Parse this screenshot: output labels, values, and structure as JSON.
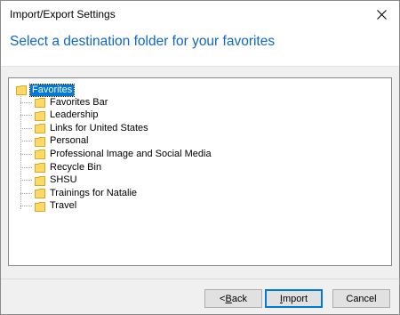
{
  "window": {
    "title": "Import/Export Settings",
    "close_icon": "close-icon"
  },
  "header": {
    "text": "Select a destination folder for your favorites",
    "color": "#0f66c8"
  },
  "tree": {
    "root": {
      "label": "Favorites",
      "selected": true
    },
    "items": [
      {
        "label": "Favorites Bar"
      },
      {
        "label": "Leadership"
      },
      {
        "label": "Links for United States"
      },
      {
        "label": "Personal"
      },
      {
        "label": "Professional Image and Social Media"
      },
      {
        "label": "Recycle Bin"
      },
      {
        "label": "SHSU"
      },
      {
        "label": "Trainings for Natalie"
      },
      {
        "label": "Travel"
      }
    ]
  },
  "buttons": {
    "back": {
      "prefix": "< ",
      "mnemonic": "B",
      "rest": "ack"
    },
    "import": {
      "mnemonic": "I",
      "rest": "mport"
    },
    "cancel": {
      "label": "Cancel"
    }
  },
  "colors": {
    "accent": "#0078d7",
    "folder": "#ffd965"
  }
}
